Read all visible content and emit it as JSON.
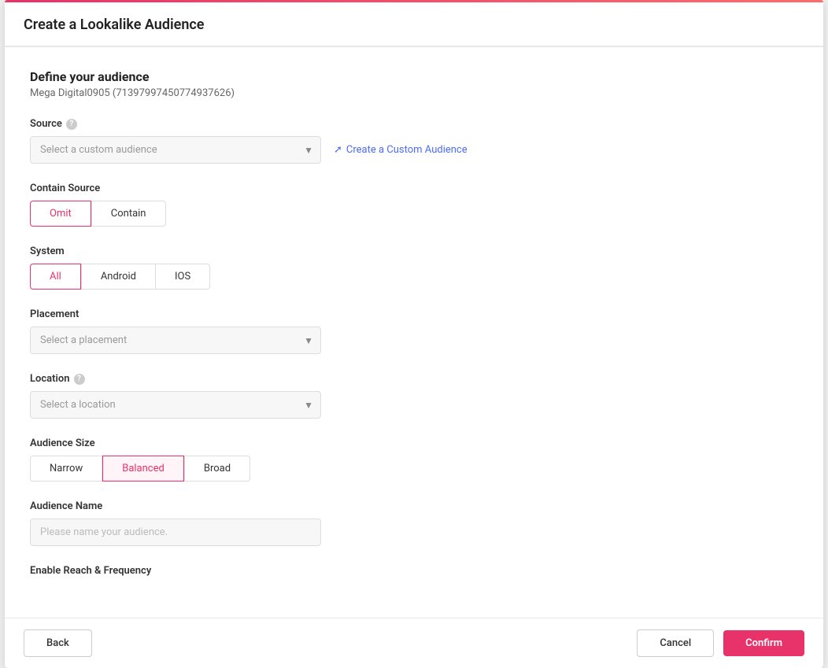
{
  "header": {
    "title": "Create a Lookalike Audience"
  },
  "form": {
    "section_title": "Define your audience",
    "section_subtitle": "Mega Digital0905 (71397997450774937626)",
    "source": {
      "label": "Source",
      "placeholder": "Select a custom audience",
      "create_link": "Create a Custom Audience"
    },
    "contain_source": {
      "label": "Contain Source",
      "options": [
        "Omit",
        "Contain"
      ],
      "active": "Omit"
    },
    "system": {
      "label": "System",
      "options": [
        "All",
        "Android",
        "IOS"
      ],
      "active": "All"
    },
    "placement": {
      "label": "Placement",
      "placeholder": "Select a placement"
    },
    "location": {
      "label": "Location",
      "placeholder": "Select a location"
    },
    "audience_size": {
      "label": "Audience Size",
      "options": [
        "Narrow",
        "Balanced",
        "Broad"
      ],
      "active": "Balanced"
    },
    "audience_name": {
      "label": "Audience Name",
      "placeholder": "Please name your audience."
    },
    "enable_rf": {
      "label": "Enable Reach & Frequency"
    }
  },
  "footer": {
    "back_label": "Back",
    "cancel_label": "Cancel",
    "confirm_label": "Confirm"
  }
}
